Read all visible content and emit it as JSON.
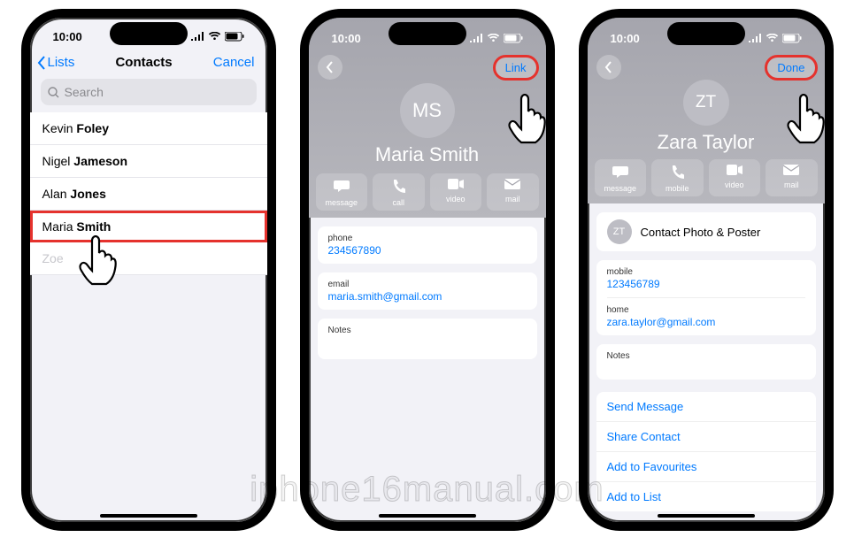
{
  "watermark": "iphone16manual.com",
  "status": {
    "time": "10:00"
  },
  "phone1": {
    "nav": {
      "back": "Lists",
      "title": "Contacts",
      "cancel": "Cancel"
    },
    "search_placeholder": "Search",
    "contacts": [
      {
        "name": "Kevin Foley"
      },
      {
        "name": "Nigel Jameson"
      },
      {
        "name": "Alan Jones"
      },
      {
        "name": "Maria Smith",
        "highlight": true
      },
      {
        "name": "Zoe",
        "faded": true
      }
    ]
  },
  "phone2": {
    "link_label": "Link",
    "initials": "MS",
    "name": "Maria Smith",
    "actions": [
      {
        "icon": "message-icon",
        "label": "message"
      },
      {
        "icon": "phone-icon",
        "label": "call"
      },
      {
        "icon": "video-icon",
        "label": "video"
      },
      {
        "icon": "mail-icon",
        "label": "mail"
      }
    ],
    "phone_label": "phone",
    "phone_value": "234567890",
    "email_label": "email",
    "email_value": "maria.smith@gmail.com",
    "notes_label": "Notes"
  },
  "phone3": {
    "done_label": "Done",
    "initials": "ZT",
    "name": "Zara Taylor",
    "actions": [
      {
        "icon": "message-icon",
        "label": "message"
      },
      {
        "icon": "phone-icon",
        "label": "mobile"
      },
      {
        "icon": "video-icon",
        "label": "video"
      },
      {
        "icon": "mail-icon",
        "label": "mail"
      }
    ],
    "poster_initials": "ZT",
    "poster_label": "Contact Photo & Poster",
    "mobile_label": "mobile",
    "mobile_value": "123456789",
    "home_label": "home",
    "home_value": "zara.taylor@gmail.com",
    "notes_label": "Notes",
    "links": [
      "Send Message",
      "Share Contact",
      "Add to Favourites",
      "Add to List"
    ]
  }
}
